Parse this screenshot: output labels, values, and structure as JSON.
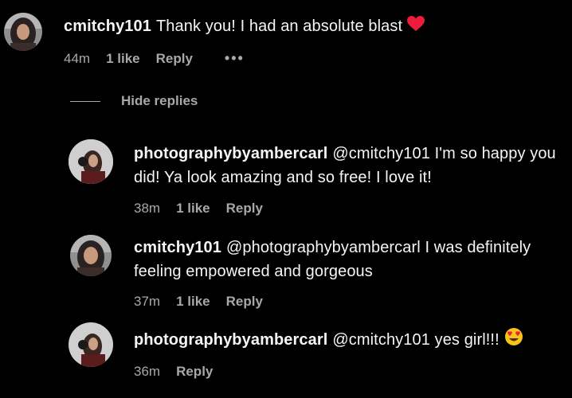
{
  "comments": [
    {
      "username": "cmitchy101",
      "mention": "",
      "text": "Thank you! I had an absolute blast",
      "emoji": "red-heart-emoji",
      "time": "44m",
      "likes": "1 like",
      "reply": "Reply",
      "more": "•••"
    },
    {
      "username": "photographybyambercarl",
      "mention": "@cmitchy101",
      "text": "I'm so happy you did! Ya look amazing and so free! I love it!",
      "time": "38m",
      "likes": "1 like",
      "reply": "Reply"
    },
    {
      "username": "cmitchy101",
      "mention": "@photographybyambercarl",
      "text": "I was definitely feeling empowered and gorgeous",
      "time": "37m",
      "likes": "1 like",
      "reply": "Reply"
    },
    {
      "username": "photographybyambercarl",
      "mention": "@cmitchy101",
      "text": "yes girl!!!",
      "emoji": "heart-eyes-emoji",
      "time": "36m",
      "reply": "Reply"
    }
  ],
  "hide_replies_label": "Hide replies",
  "colors": {
    "background": "#000000",
    "text": "#f5f5f5",
    "meta": "#a8a8a8",
    "heart": "#ed1c3a",
    "heart_eyes_face": "#f5c518"
  }
}
